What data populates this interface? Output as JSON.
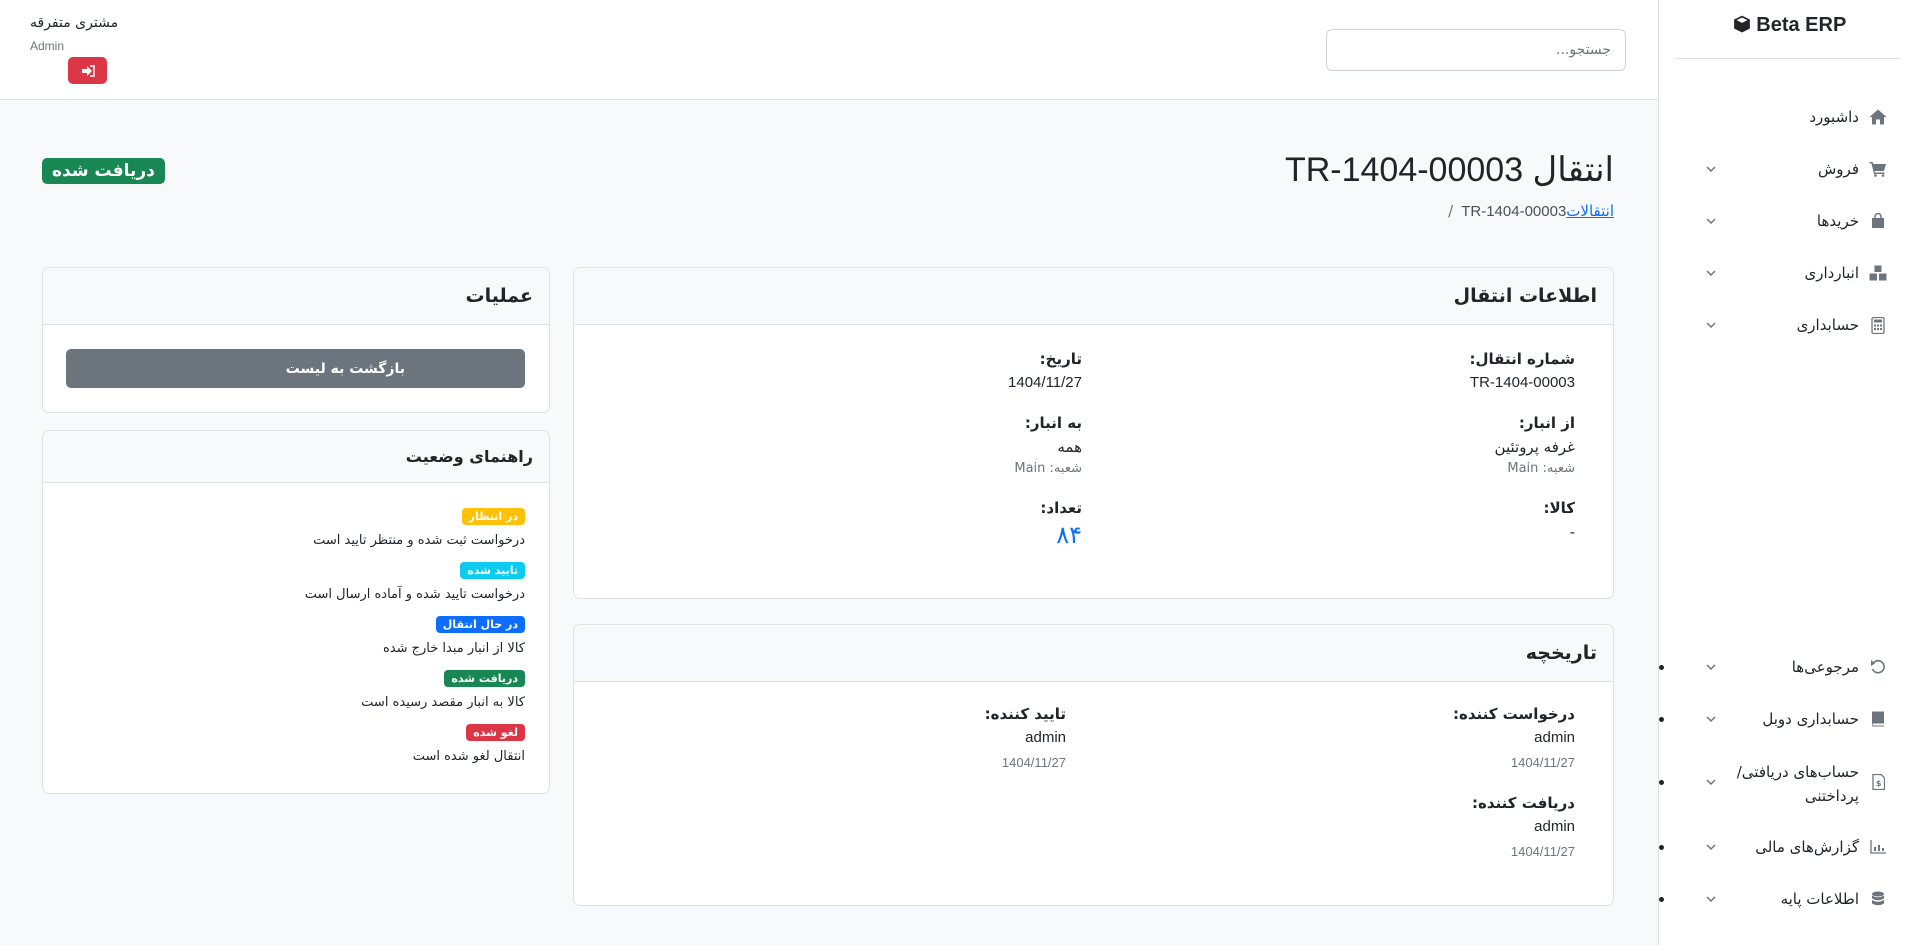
{
  "app": {
    "brand": "Beta ERP"
  },
  "sidebar": {
    "items": [
      {
        "label": "داشبورد",
        "icon": "home-icon"
      },
      {
        "label": "فروش",
        "icon": "cart-icon"
      },
      {
        "label": "خریدها",
        "icon": "bag-icon"
      },
      {
        "label": "انبارداری",
        "icon": "boxes-icon"
      },
      {
        "label": "حسابداری",
        "icon": "calculator-icon"
      },
      {
        "label": "مرجوعی‌ها",
        "icon": "undo-icon"
      },
      {
        "label": "حسابداری دوبل",
        "icon": "book-icon"
      },
      {
        "label": "حساب‌های دریافتی/",
        "label2": "پرداختنی",
        "icon": "invoice-icon"
      },
      {
        "label": "گزارش‌های مالی",
        "icon": "chart-icon"
      },
      {
        "label": "اطلاعات پایه",
        "icon": "database-icon"
      }
    ]
  },
  "header": {
    "search_placeholder": "جستجو...",
    "user_name": "مشتری متفرقه",
    "user_role": "Admin"
  },
  "page": {
    "title": "انتقال TR-1404-00003",
    "breadcrumb_link": "انتقالات",
    "breadcrumb_current": "TR-1404-00003",
    "breadcrumb_sep": "/",
    "status": "دریافت شده"
  },
  "transfer_info": {
    "title": "اطلاعات انتقال",
    "number_label": "شماره انتقال:",
    "number_value": "TR-1404-00003",
    "date_label": "تاریخ:",
    "date_value": "1404/11/27",
    "from_label": "از انبار:",
    "from_value": "غرفه پروتئین",
    "from_branch": "شعبه: Main",
    "to_label": "به انبار:",
    "to_value": "همه",
    "to_branch": "شعبه: Main",
    "product_label": "کالا:",
    "product_value": "-",
    "qty_label": "تعداد:",
    "qty_value": "۸۴"
  },
  "history": {
    "title": "تاریخچه",
    "requester_label": "درخواست کننده:",
    "requester_value": "admin",
    "requester_date": "1404/11/27",
    "approver_label": "تایید کننده:",
    "approver_value": "admin",
    "approver_date": "1404/11/27",
    "receiver_label": "دریافت کننده:",
    "receiver_value": "admin",
    "receiver_date": "1404/11/27"
  },
  "actions": {
    "title": "عملیات",
    "back_label": "بازگشت به لیست"
  },
  "legend": {
    "title": "راهنمای وضعیت",
    "items": [
      {
        "badge": "در انتظار",
        "text": "درخواست ثبت شده و منتظر تایید است",
        "color": "#ffc107"
      },
      {
        "badge": "تایید شده",
        "text": "درخواست تایید شده و آماده ارسال است",
        "color": "#0dcaf0"
      },
      {
        "badge": "در حال انتقال",
        "text": "کالا از انبار مبدا خارج شده",
        "color": "#0d6efd"
      },
      {
        "badge": "دریافت شده",
        "text": "کالا به انبار مقصد رسیده است",
        "color": "#198754"
      },
      {
        "badge": "لغو شده",
        "text": "انتقال لغو شده است",
        "color": "#dc3545"
      }
    ]
  }
}
